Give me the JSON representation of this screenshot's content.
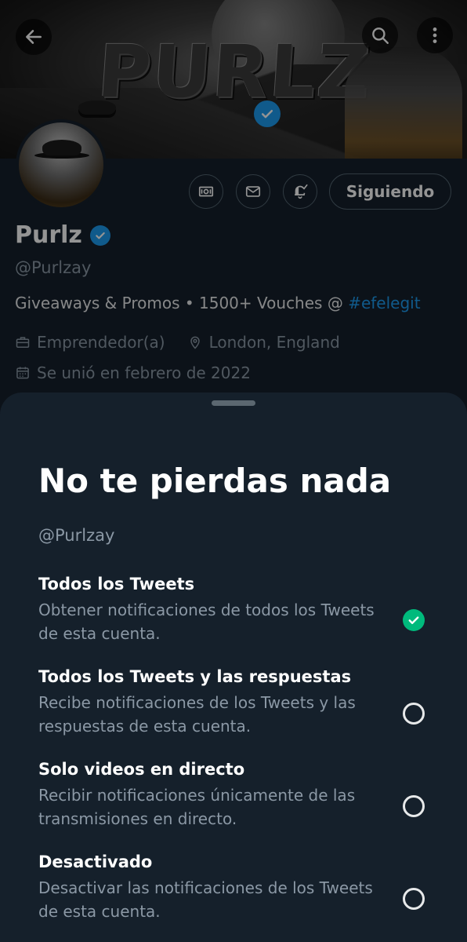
{
  "banner": {
    "logo_text": "PURLZ"
  },
  "profile": {
    "follow_label": "Siguiendo",
    "name": "Purlz",
    "handle": "@Purlzay",
    "bio_text": "Giveaways & Promos • 1500+ Vouches @ ",
    "bio_hashtag": "#efelegit",
    "category": "Emprendedor(a)",
    "location": "London, England",
    "joined": "Se unió en febrero de 2022"
  },
  "sheet": {
    "title": "No te pierdas nada",
    "handle": "@Purlzay",
    "options": [
      {
        "title": "Todos los Tweets",
        "description": "Obtener notificaciones de todos los Tweets de esta cuenta.",
        "selected": true
      },
      {
        "title": "Todos los Tweets y las respuestas",
        "description": "Recibe notificaciones de los Tweets y las respuestas de esta cuenta.",
        "selected": false
      },
      {
        "title": "Solo videos en directo",
        "description": "Recibir notificaciones únicamente de las transmisiones en directo.",
        "selected": false
      },
      {
        "title": "Desactivado",
        "description": "Desactivar las notificaciones de los Tweets de esta cuenta.",
        "selected": false
      }
    ]
  },
  "colors": {
    "background": "#15202b",
    "accent": "#1d9bf0",
    "selected": "#00ba7c",
    "secondary_text": "#8b98a5"
  },
  "icons": {
    "back": "arrow-left-icon",
    "search": "search-icon",
    "more": "more-vertical-icon",
    "tip": "money-icon",
    "message": "envelope-icon",
    "notifications": "bell-check-icon",
    "category": "briefcase-icon",
    "location": "location-pin-icon",
    "joined": "calendar-icon",
    "verified": "verified-badge-icon"
  }
}
